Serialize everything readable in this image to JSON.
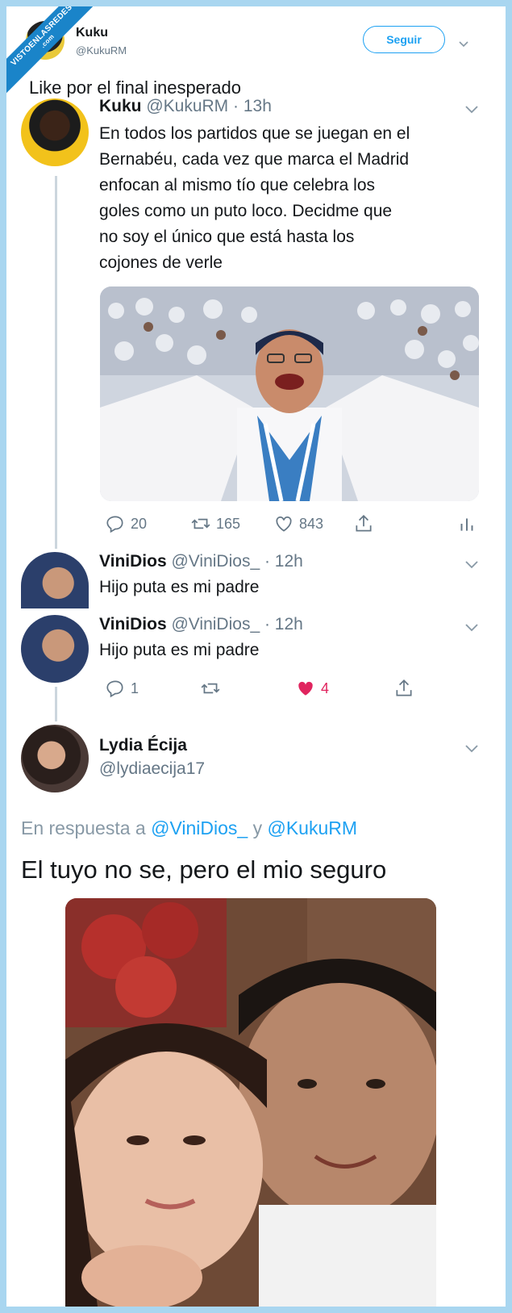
{
  "watermark": {
    "line1": "VISTOENLASREDES",
    "line2": ".com"
  },
  "header": {
    "name": "Kuku",
    "handle": "@KukuRM",
    "follow_label": "Seguir"
  },
  "caption": "Like por el final inesperado",
  "tweets": [
    {
      "name": "Kuku",
      "meta": " @KukuRM · 13h",
      "lines": [
        "En todos los partidos que se juegan en el",
        "Bernabéu, cada vez que marca el Madrid",
        "enfocan al mismo tío que celebra los",
        "goles como un puto loco. Decidme que",
        "no soy el único que está hasta los",
        "cojones de verle"
      ],
      "replies": "20",
      "retweets": "165",
      "likes": "843"
    },
    {
      "name": "ViniDios",
      "meta": " @ViniDios_ · 12h",
      "text": "Hijo puta es mi padre"
    },
    {
      "name": "ViniDios",
      "meta": " @ViniDios_ · 12h",
      "text": "Hijo puta es mi padre",
      "replies": "1",
      "likes": "4"
    }
  ],
  "reply": {
    "name": "Lydia Écija",
    "handle": "@lydiaecija17",
    "reply_prefix": "En respuesta a ",
    "mention1": "@ViniDios_",
    "joiner": " y ",
    "mention2": "@KukuRM",
    "text": "El tuyo no se, pero el mio seguro"
  },
  "colors": {
    "accent": "#1da1f2",
    "like": "#e0245e",
    "muted": "#657786",
    "watermark": "#1a84c9"
  },
  "icons": [
    "reply-icon",
    "retweet-icon",
    "heart-icon",
    "share-icon",
    "analytics-icon",
    "chevron-down-icon"
  ]
}
